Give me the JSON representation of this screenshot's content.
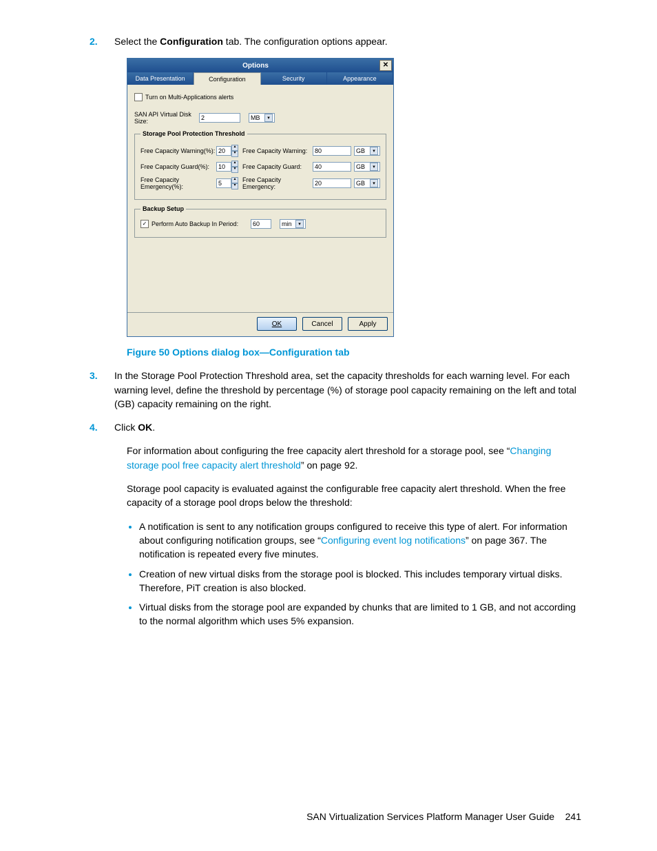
{
  "steps": {
    "s2_num": "2.",
    "s2_a": "Select the ",
    "s2_bold": "Configuration",
    "s2_b": " tab. The configuration options appear.",
    "s3_num": "3.",
    "s3": "In the Storage Pool Protection Threshold area, set the capacity thresholds for each warning level. For each warning level, define the threshold by percentage (%) of storage pool capacity remaining on the left and total (GB) capacity remaining on the right.",
    "s4_num": "4.",
    "s4_a": "Click ",
    "s4_bold": "OK",
    "s4_b": "."
  },
  "figure_caption": "Figure 50 Options dialog box—Configuration tab",
  "para1_a": "For information about configuring the free capacity alert threshold for a storage pool, see “",
  "para1_link": "Changing storage pool free capacity alert threshold",
  "para1_b": "” on page 92.",
  "para2": "Storage pool capacity is evaluated against the configurable free capacity alert threshold. When the free capacity of a storage pool drops below the threshold:",
  "bullets": {
    "b1_a": "A notification is sent to any notification groups configured to receive this type of alert. For information about configuring notification groups, see “",
    "b1_link": "Configuring event log notifications",
    "b1_b": "” on page 367. The notification is repeated every five minutes.",
    "b2": "Creation of new virtual disks from the storage pool is blocked. This includes temporary virtual disks. Therefore, PiT creation is also blocked.",
    "b3": "Virtual disks from the storage pool are expanded by chunks that are limited to 1 GB, and not according to the normal algorithm which uses 5% expansion."
  },
  "footer_text": "SAN Virtualization Services Platform Manager User Guide",
  "footer_page": "241",
  "dialog": {
    "title": "Options",
    "tabs": [
      "Data Presentation",
      "Configuration",
      "Security",
      "Appearance"
    ],
    "multi_apps_label": "Turn on Multi-Applications alerts",
    "vdisk_size_label": "SAN API Virtual Disk Size:",
    "vdisk_size_value": "2",
    "vdisk_size_unit": "MB",
    "fs_threshold_legend": "Storage Pool Protection Threshold",
    "rows": [
      {
        "l1": "Free Capacity Warning(%):",
        "pct": "20",
        "l2": "Free Capacity Warning:",
        "val": "80",
        "unit": "GB"
      },
      {
        "l1": "Free Capacity Guard(%):",
        "pct": "10",
        "l2": "Free Capacity Guard:",
        "val": "40",
        "unit": "GB"
      },
      {
        "l1": "Free Capacity Emergency(%):",
        "pct": "5",
        "l2": "Free Capacity Emergency:",
        "val": "20",
        "unit": "GB"
      }
    ],
    "fs_backup_legend": "Backup Setup",
    "backup_label": "Perform Auto Backup In Period:",
    "backup_value": "60",
    "backup_unit": "min",
    "btn_ok": "OK",
    "btn_cancel": "Cancel",
    "btn_apply": "Apply"
  }
}
